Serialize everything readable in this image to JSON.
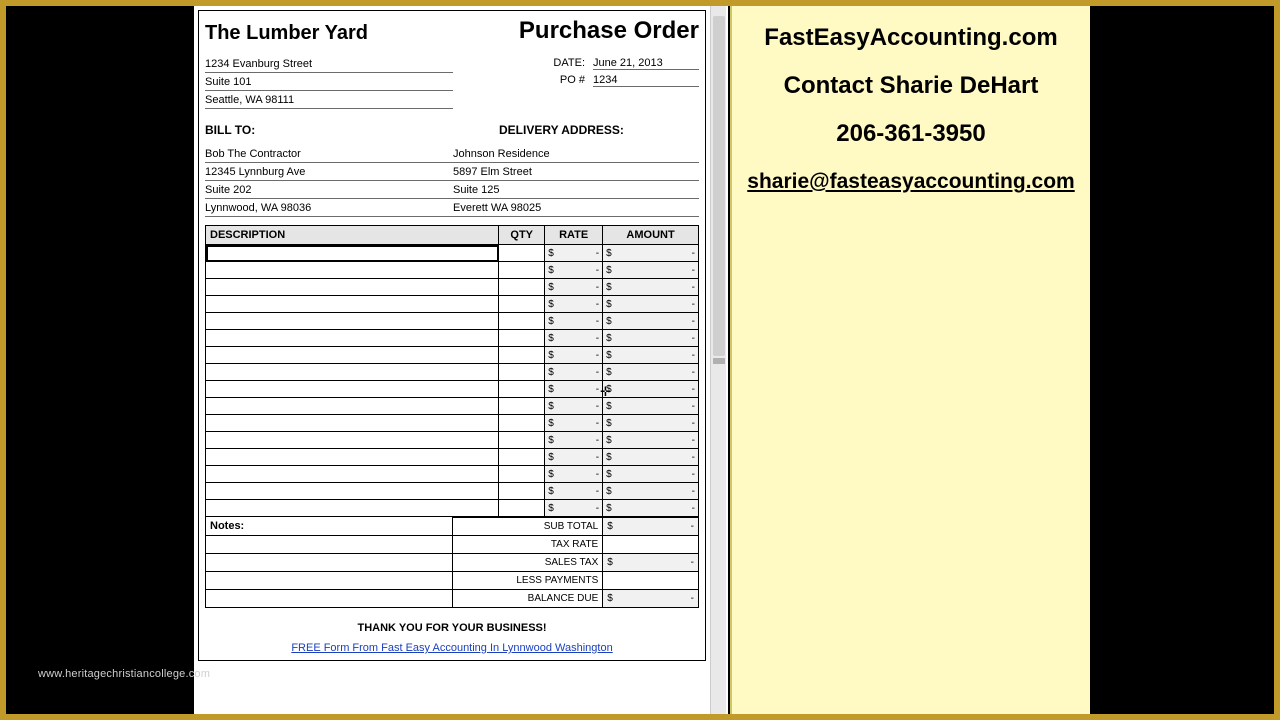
{
  "header": {
    "company": "The Lumber Yard",
    "title": "Purchase Order",
    "addr1": "1234 Evanburg Street",
    "addr2": "Suite 101",
    "addr3": "Seattle, WA 98111",
    "date_label": "DATE:",
    "date_value": "June 21, 2013",
    "po_label": "PO #",
    "po_value": "1234"
  },
  "sections": {
    "billto_label": "BILL TO:",
    "delivery_label": "DELIVERY ADDRESS:"
  },
  "billto": {
    "l1": "Bob The Contractor",
    "l2": "12345 Lynnburg Ave",
    "l3": "Suite 202",
    "l4": "Lynnwood, WA 98036"
  },
  "delivery": {
    "l1": "Johnson Residence",
    "l2": "5897 Elm Street",
    "l3": "Suite 125",
    "l4": "Everett WA 98025"
  },
  "table": {
    "headers": {
      "desc": "DESCRIPTION",
      "qty": "QTY",
      "rate": "RATE",
      "amount": "AMOUNT"
    },
    "currency": "$",
    "dash": "-",
    "row_count": 16
  },
  "totals": {
    "notes_label": "Notes:",
    "subtotal_label": "SUB TOTAL",
    "taxrate_label": "TAX RATE",
    "salestax_label": "SALES TAX",
    "lesspay_label": "LESS PAYMENTS",
    "balance_label": "BALANCE DUE",
    "currency": "$",
    "dash": "-"
  },
  "footer": {
    "thanks": "THANK YOU FOR YOUR BUSINESS!",
    "free": "FREE Form From Fast Easy Accounting In Lynnwood Washington"
  },
  "side": {
    "site": "FastEasyAccounting.com",
    "contact": "Contact Sharie DeHart",
    "phone": "206-361-3950",
    "email": "sharie@fasteasyaccounting.com"
  },
  "watermark": "www.heritagechristiancollege.com"
}
